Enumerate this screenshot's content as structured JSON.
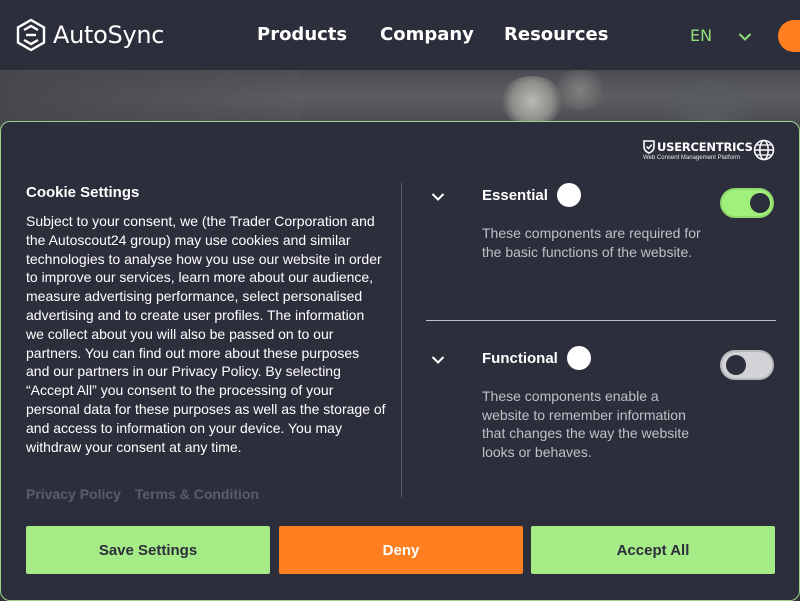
{
  "header": {
    "logo_text": "AutoSync",
    "nav": [
      "Products",
      "Company",
      "Resources"
    ],
    "language": "EN"
  },
  "modal": {
    "brand": {
      "name": "USERCENTRICS",
      "tagline": "Web Consent Management Platform"
    },
    "title": "Cookie Settings",
    "description": "Subject to your consent, we (the Trader Corporation and the Autoscout24 group) may use cookies and similar technologies to analyse how you use our website in order to improve our services, learn more about our audience, measure advertising performance, select personalised advertising and to create user profiles. The information we collect about you will also be passed on to our partners. You can find out more about these purposes and our partners in our Privacy Policy. By selecting “Accept All” you consent to the processing of your personal data for these purposes as well as the storage of and access to information on your device. You may withdraw your consent at any time.",
    "links": [
      "Privacy Policy",
      "Terms & Condition"
    ],
    "categories": [
      {
        "name": "Essential",
        "description": "These components are required for the basic functions of the website.",
        "enabled": true
      },
      {
        "name": "Functional",
        "description": "These components enable a website to remember information that changes the way the website looks or behaves.",
        "enabled": false
      }
    ],
    "buttons": {
      "save": "Save Settings",
      "deny": "Deny",
      "accept_all": "Accept All"
    }
  },
  "colors": {
    "background": "#2c2e3b",
    "accent_green": "#a6ec86",
    "accent_orange": "#ff7f21",
    "language_text": "#8fe07a"
  },
  "icons": [
    "autosync-logo-icon",
    "chevron-down-icon",
    "shield-icon",
    "globe-icon",
    "info-icon"
  ]
}
